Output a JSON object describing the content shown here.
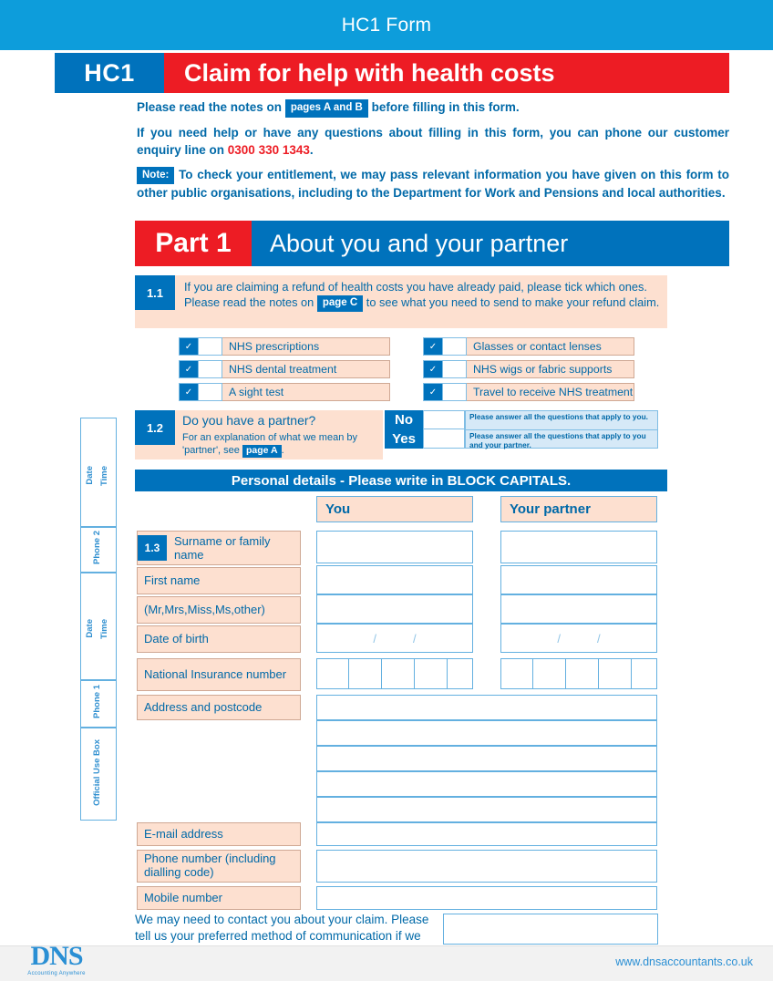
{
  "window": {
    "title": "HC1 Form"
  },
  "title_strip": {
    "code": "HC1",
    "heading": "Claim for help with health costs"
  },
  "intro": {
    "line1_before": "Please read the notes on",
    "line1_tag": "pages A and B",
    "line1_after": "before filling in this form.",
    "line2_before": "If you need help or have any questions about filling in this form, you can phone our customer enquiry line on",
    "line2_phone": "0300 330 1343",
    "line2_after": ".",
    "note_tag": "Note:",
    "note_text": "To check your entitlement, we may pass relevant information you have given on this form to other public organisations, including to the Department for Work and Pensions and local authorities."
  },
  "part": {
    "number": "Part 1",
    "title": "About you and your partner"
  },
  "q11": {
    "number": "1.1",
    "text_before": "If you are claiming a refund of health costs you have already paid, please tick which ones.  Please read the notes on",
    "tag": "page C",
    "text_after": "to see what you need to send to make your refund claim.",
    "check_icon": "✓",
    "options_left": [
      "NHS prescriptions",
      "NHS dental treatment",
      "A sight test"
    ],
    "options_right": [
      "Glasses or contact lenses",
      "NHS wigs or fabric supports",
      "Travel to receive NHS treatment"
    ]
  },
  "q12": {
    "number": "1.2",
    "question": "Do you have a partner?",
    "sub_before": "For an explanation of what we mean by 'partner', see",
    "sub_tag": "page A",
    "sub_after": ".",
    "no_label": "No",
    "yes_label": "Yes",
    "no_hint": "Please answer all the questions that apply to you.",
    "yes_hint": "Please answer all the questions that apply to you and your partner."
  },
  "personal": {
    "bar": "Personal details - Please write in BLOCK CAPITALS.",
    "col_you": "You",
    "col_partner": "Your partner",
    "row_13_number": "1.3",
    "row_13_label": "Surname or family name",
    "row_first_name": "First name",
    "row_title": "(Mr,Mrs,Miss,Ms,other)",
    "row_dob": "Date of birth",
    "dob_sep": "/",
    "row_ni": "National Insurance number",
    "row_address": "Address and postcode",
    "row_email": "E-mail address",
    "row_phone": "Phone number (including dialling code)",
    "row_mobile": "Mobile number"
  },
  "sidebar": {
    "boxes": [
      "Date Time",
      "Phone 2",
      "Date Time",
      "Phone 1",
      "Official Use Box"
    ],
    "date_label": "Date",
    "time_label": "Time",
    "phone2_label": "Phone 2",
    "phone1_label": "Phone 1",
    "official_label": "Official Use Box"
  },
  "contact_note": "We may need to contact you about your claim. Please tell us your preferred method of communication if we do.",
  "footer": {
    "logo_mark": "DNS",
    "logo_tagline": "Accounting Anywhere",
    "url": "www.dnsaccountants.co.uk"
  },
  "colors": {
    "banner_blue": "#0d9ddb",
    "brand_blue": "#0072bc",
    "brand_red": "#ed1c24",
    "peach": "#fde0d0",
    "text_blue": "#0069a8",
    "light_blue_fill": "#d6e9f7",
    "rule_blue": "#63b0e0"
  }
}
